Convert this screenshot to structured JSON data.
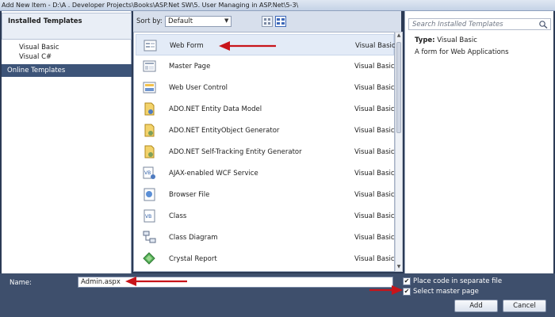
{
  "window": {
    "title": "Add New Item - D:\\A . Developer Projects\\Books\\ASP.Net SW\\5. User Managing  in ASP.Net\\5-3\\"
  },
  "left_pane": {
    "installed_title": "Installed Templates",
    "languages": [
      "Visual Basic",
      "Visual C#"
    ],
    "online_label": "Online Templates"
  },
  "sort": {
    "label": "Sort by:",
    "value": "Default"
  },
  "templates": [
    {
      "name": "Web Form",
      "language": "Visual Basic",
      "icon": "web-form-icon"
    },
    {
      "name": "Master Page",
      "language": "Visual Basic",
      "icon": "master-page-icon"
    },
    {
      "name": "Web User Control",
      "language": "Visual Basic",
      "icon": "user-control-icon"
    },
    {
      "name": "ADO.NET Entity Data Model",
      "language": "Visual Basic",
      "icon": "entity-model-icon"
    },
    {
      "name": "ADO.NET EntityObject Generator",
      "language": "Visual Basic",
      "icon": "entity-generator-icon"
    },
    {
      "name": "ADO.NET Self-Tracking Entity Generator",
      "language": "Visual Basic",
      "icon": "self-tracking-generator-icon"
    },
    {
      "name": "AJAX-enabled WCF Service",
      "language": "Visual Basic",
      "icon": "wcf-service-icon"
    },
    {
      "name": "Browser File",
      "language": "Visual Basic",
      "icon": "browser-file-icon"
    },
    {
      "name": "Class",
      "language": "Visual Basic",
      "icon": "class-icon"
    },
    {
      "name": "Class Diagram",
      "language": "Visual Basic",
      "icon": "class-diagram-icon"
    },
    {
      "name": "Crystal Report",
      "language": "Visual Basic",
      "icon": "crystal-report-icon"
    }
  ],
  "details": {
    "search_placeholder": "Search Installed Templates",
    "type_key": "Type:",
    "type_value": "Visual Basic",
    "description": "A form for Web Applications"
  },
  "bottom": {
    "name_label": "Name:",
    "name_value": "Admin.aspx",
    "code_separate_label": "Place code in separate file",
    "code_separate_checked": "✔",
    "master_page_label": "Select master page",
    "master_page_checked": "✔",
    "add_label": "Add",
    "cancel_label": "Cancel"
  },
  "colors": {
    "annotation_arrow": "#c8141a",
    "selected_category": "#3d5478"
  }
}
